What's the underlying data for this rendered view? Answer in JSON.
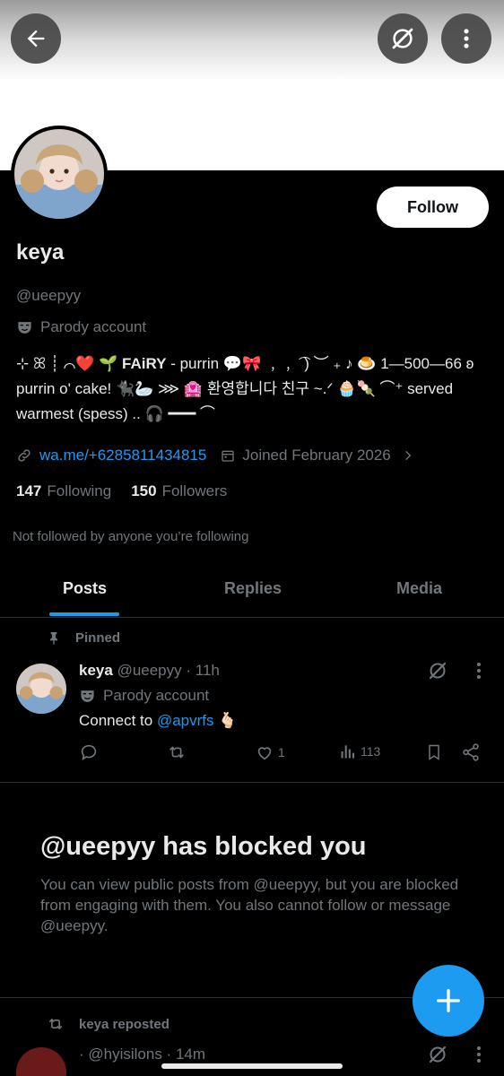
{
  "profile": {
    "name": "keya",
    "handle": "@ueepyy",
    "parody_label": "Parody account",
    "follow_label": "Follow",
    "bio_lines": [
      "⊹ ꕤ ┊ ⌒❤️ 🌱",
      "FAiRY",
      "-  purrin 💬🎀 ﹐﹐ ͡ ) ︶ ₊ ♪ 🍮 1—500—66 ʚ",
      "purrin o' cake! 🐈‍⬛🦢 ⋙ 🏩 환영합니다 친구 ~.ᐟ 🧁🍡 ⌒⁺ served",
      "warmest (spess) .. 🎧 ━━━ ⌒"
    ],
    "link": "wa.me/+6285811434815",
    "joined": "Joined February 2026",
    "following_count": "147",
    "following_label": "Following",
    "followers_count": "150",
    "followers_label": "Followers",
    "not_followed_text": "Not followed by anyone you’re following"
  },
  "tabs": [
    {
      "label": "Posts"
    },
    {
      "label": "Replies"
    },
    {
      "label": "Media"
    }
  ],
  "pinned_post": {
    "pinned_label": "Pinned",
    "name": "keya",
    "handle_time": "@ueepyy · 11h",
    "parody_label": "Parody account",
    "text_prefix": "Connect to",
    "mention": "@apvrfs",
    "emoji": "🫰🏻",
    "likes": "1",
    "views": "113"
  },
  "blocked": {
    "title": "@ueepyy has blocked you",
    "text": "You can view public posts from @ueepyy, but you are blocked from engaging with them. You also cannot follow or message @ueepyy."
  },
  "repost": {
    "label": "keya reposted",
    "partial_handle": "· @hyisilons · 14m"
  },
  "icons": {
    "back": "back-arrow-icon",
    "grok": "grok-icon",
    "more": "more-vertical-icon",
    "compose": "plus-icon"
  },
  "colors": {
    "accent": "#1d9bf0",
    "background": "#000000",
    "muted": "#71767b",
    "text": "#e7e9ea"
  }
}
